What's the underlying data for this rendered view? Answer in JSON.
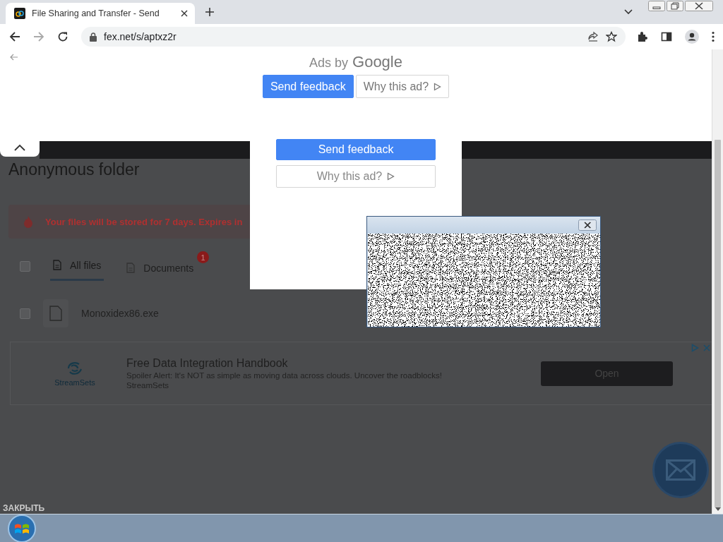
{
  "browser": {
    "tab_title": "File Sharing and Transfer - Send",
    "address": "fex.net/s/aptxz2r"
  },
  "top_ad": {
    "label": "Ads by",
    "brand": "Google",
    "buttons": [
      {
        "label": "Send feedback",
        "kind": "primary"
      },
      {
        "label": "Why this ad?",
        "kind": "secondary"
      }
    ]
  },
  "page": {
    "title": "Anonymous folder",
    "notice": "Your files will be stored for 7 days. Expires in",
    "select_all_checked": false,
    "tabs": [
      {
        "label": "All files",
        "selected": true
      },
      {
        "label": "Documents",
        "selected": false,
        "badge": "1"
      }
    ],
    "files": [
      {
        "name": "Monoxidex86.exe",
        "checked": false
      }
    ],
    "ad": {
      "brand": "StreamSets",
      "title": "Free Data Integration Handbook",
      "text": "Spoiler Alert: It's NOT as simple as moving data across clouds. Uncover the roadblocks!",
      "source": "StreamSets",
      "button": "Open"
    },
    "close_label": "ЗАКРЫТЬ"
  },
  "ad_modal": {
    "buttons": [
      {
        "label": "Send feedback",
        "kind": "primary"
      },
      {
        "label": "Why this ad?",
        "kind": "secondary"
      }
    ]
  }
}
